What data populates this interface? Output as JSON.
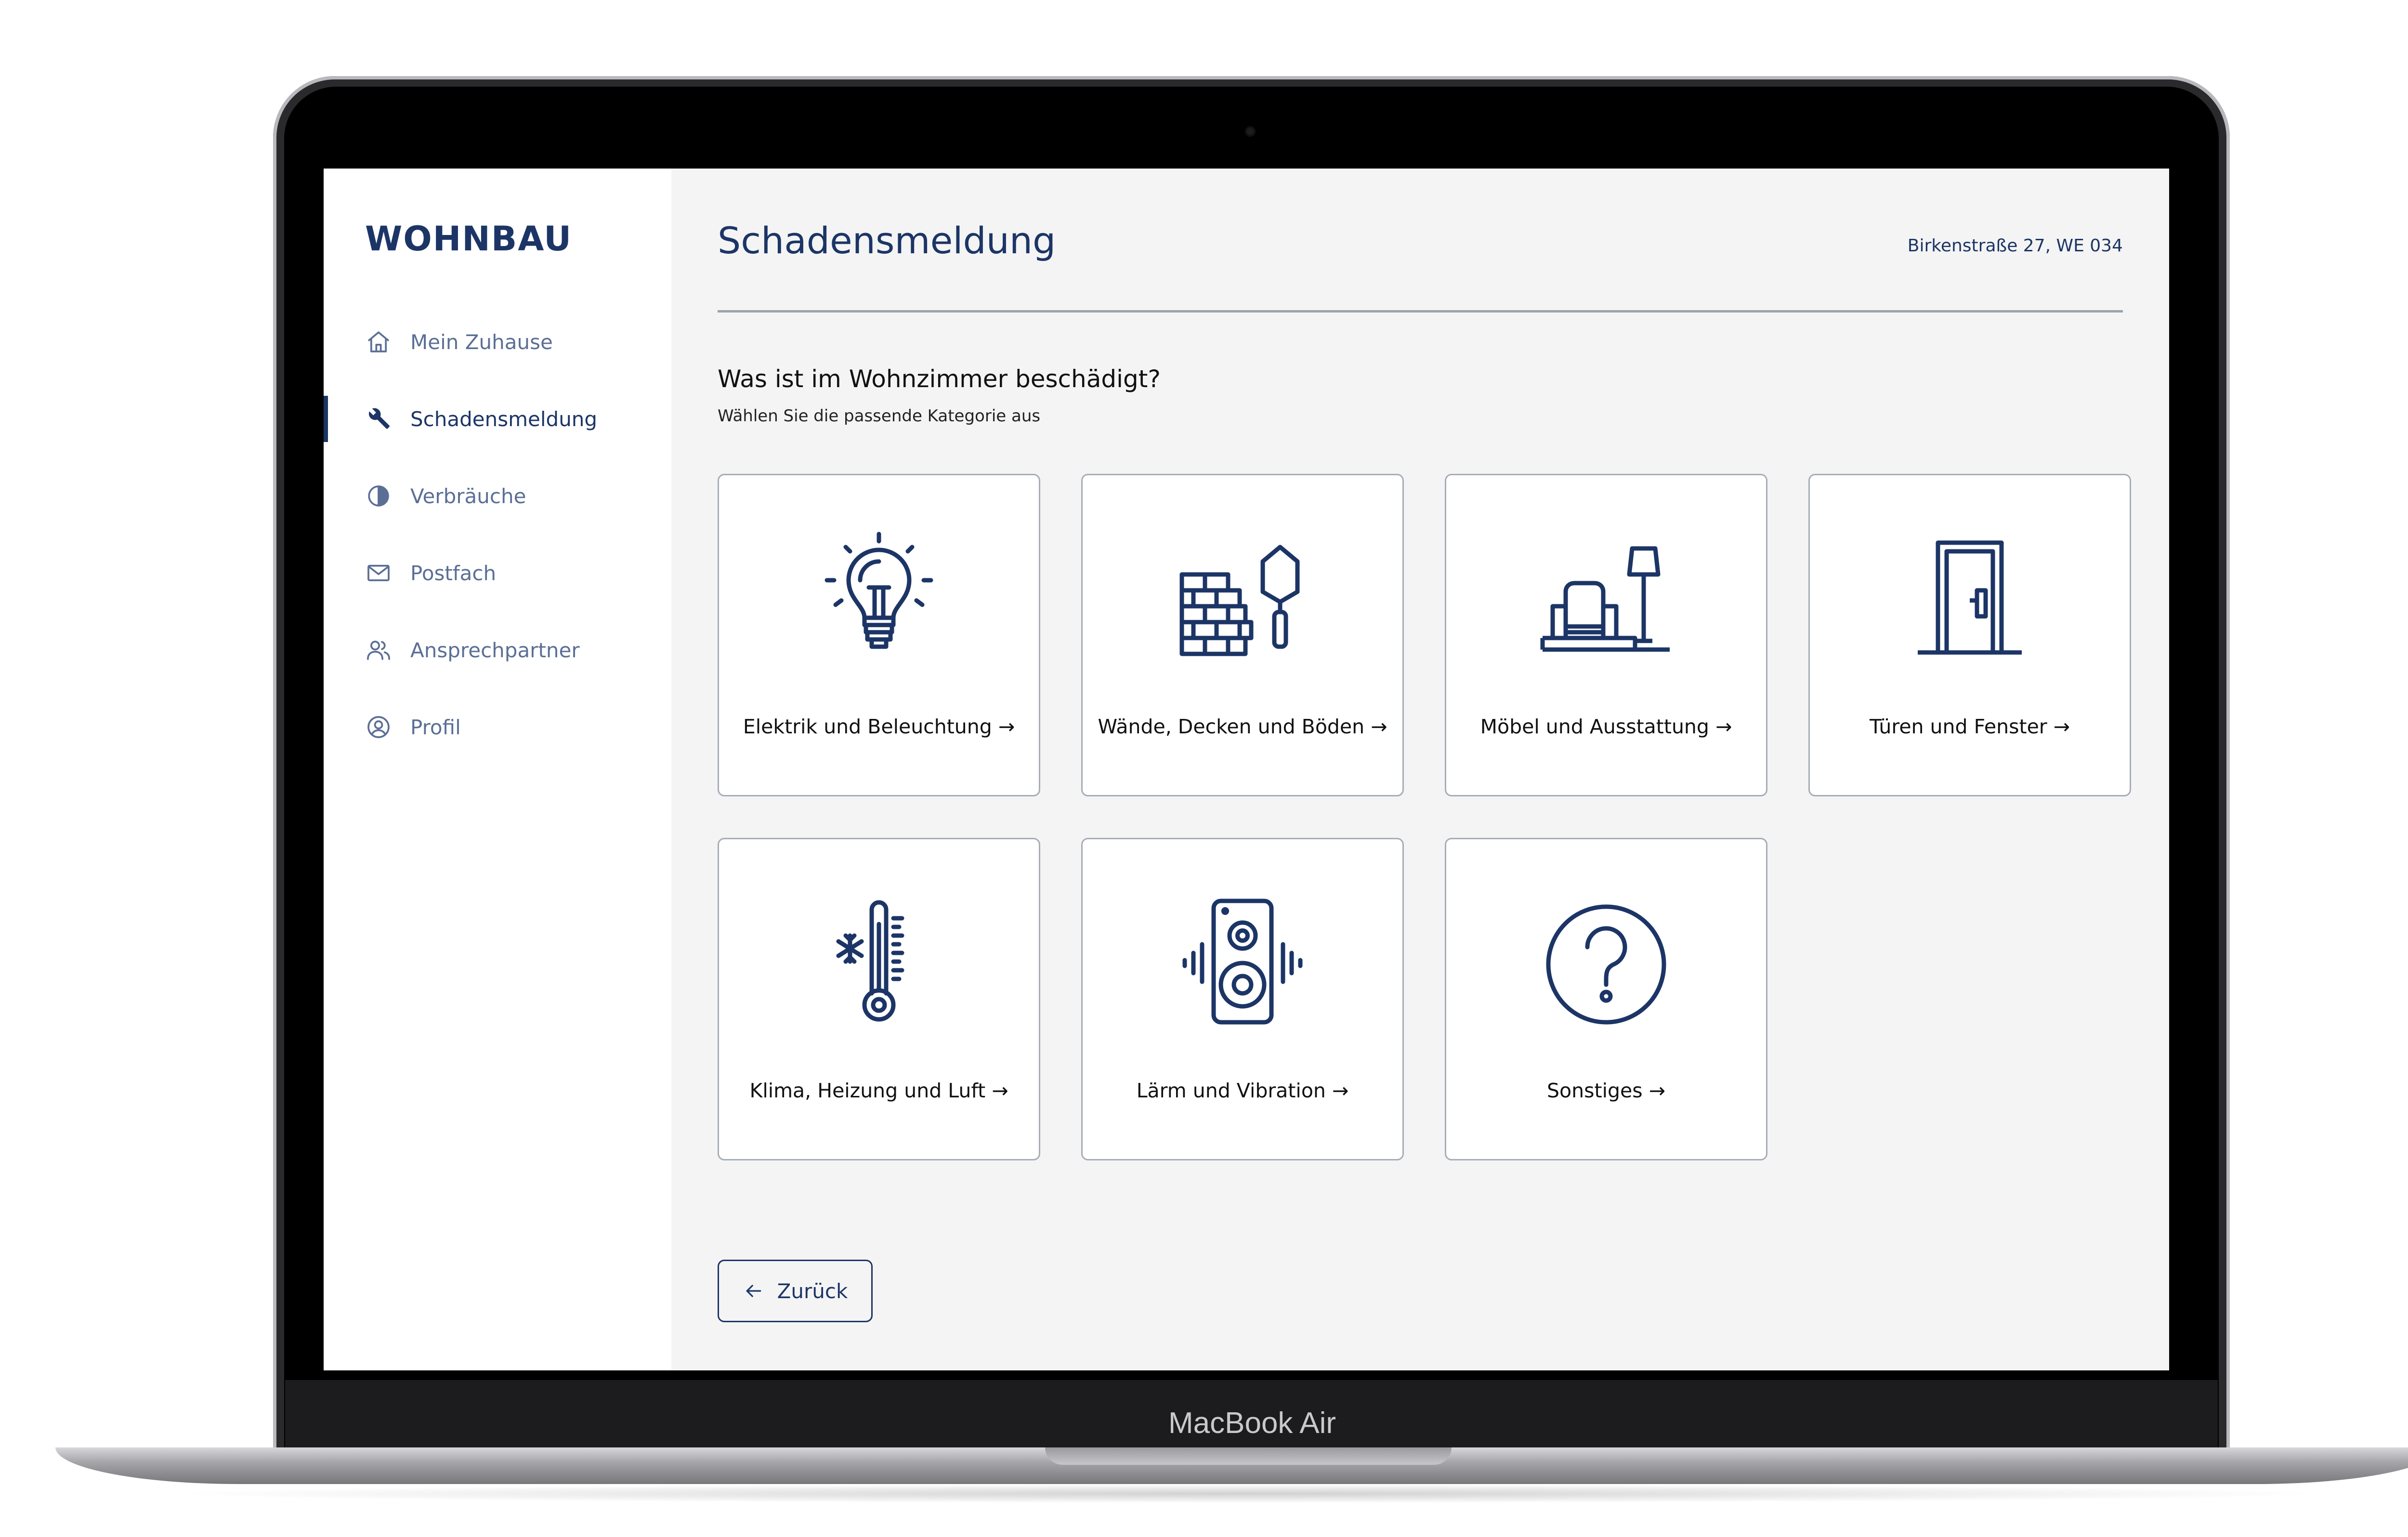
{
  "device": {
    "label": "MacBook Air"
  },
  "brand": {
    "name": "WOHNBAU",
    "primary_color": "#1c3566",
    "muted_color": "#5b6f95"
  },
  "sidebar": {
    "items": [
      {
        "label": "Mein Zuhause",
        "icon": "home-icon",
        "active": false
      },
      {
        "label": "Schadensmeldung",
        "icon": "wrench-icon",
        "active": true
      },
      {
        "label": "Verbräuche",
        "icon": "pie-chart-icon",
        "active": false
      },
      {
        "label": "Postfach",
        "icon": "mail-icon",
        "active": false
      },
      {
        "label": "Ansprechpartner",
        "icon": "users-icon",
        "active": false
      },
      {
        "label": "Profil",
        "icon": "user-circle-icon",
        "active": false
      }
    ]
  },
  "header": {
    "title": "Schadensmeldung",
    "address": "Birkenstraße 27, WE 034"
  },
  "content": {
    "question": "Was ist im Wohnzimmer beschädigt?",
    "hint": "Wählen Sie die passende Kategorie aus",
    "categories": [
      {
        "label": "Elektrik und Beleuchtung →",
        "icon": "lightbulb-icon"
      },
      {
        "label": "Wände, Decken und Böden →",
        "icon": "brick-wall-trowel-icon"
      },
      {
        "label": "Möbel und Ausstattung →",
        "icon": "furniture-icon"
      },
      {
        "label": "Türen und Fenster →",
        "icon": "door-icon"
      },
      {
        "label": "Klima, Heizung und Luft →",
        "icon": "thermometer-icon"
      },
      {
        "label": "Lärm und Vibration →",
        "icon": "speaker-icon"
      },
      {
        "label": "Sonstiges →",
        "icon": "question-circle-icon"
      }
    ],
    "back_label": "Zurück"
  }
}
